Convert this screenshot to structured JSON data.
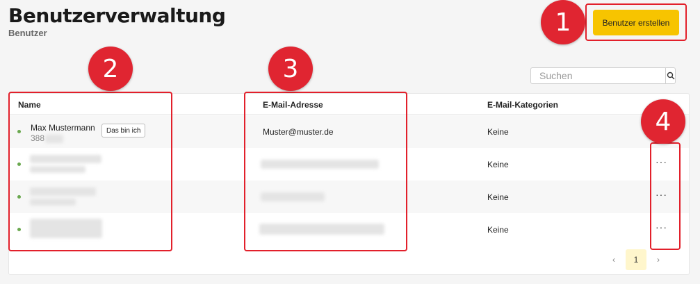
{
  "header": {
    "title": "Benutzerverwaltung",
    "subtitle": "Benutzer"
  },
  "toolbar": {
    "create_label": "Benutzer erstellen"
  },
  "search": {
    "placeholder": "Suchen"
  },
  "table": {
    "columns": [
      "Name",
      "E-Mail-Adresse",
      "E-Mail-Kategorien"
    ],
    "rows": [
      {
        "name": "Max Mustermann",
        "sub": "388",
        "badge": "Das bin ich",
        "email": "Muster@muster.de",
        "categories": "Keine",
        "more": ""
      },
      {
        "name": "",
        "sub": "",
        "badge": "",
        "email": "",
        "categories": "Keine",
        "more": "···"
      },
      {
        "name": "",
        "sub": "",
        "badge": "",
        "email": "",
        "categories": "Keine",
        "more": "···"
      },
      {
        "name": "",
        "sub": "",
        "badge": "",
        "email": "",
        "categories": "Keine",
        "more": "···"
      }
    ]
  },
  "pagination": {
    "current": "1",
    "prev": "‹",
    "next": "›"
  },
  "annotations": [
    "1",
    "2",
    "3",
    "4"
  ],
  "colors": {
    "accent": "#f7c400",
    "annotation": "#e02531",
    "status_active": "#6aa84f"
  }
}
